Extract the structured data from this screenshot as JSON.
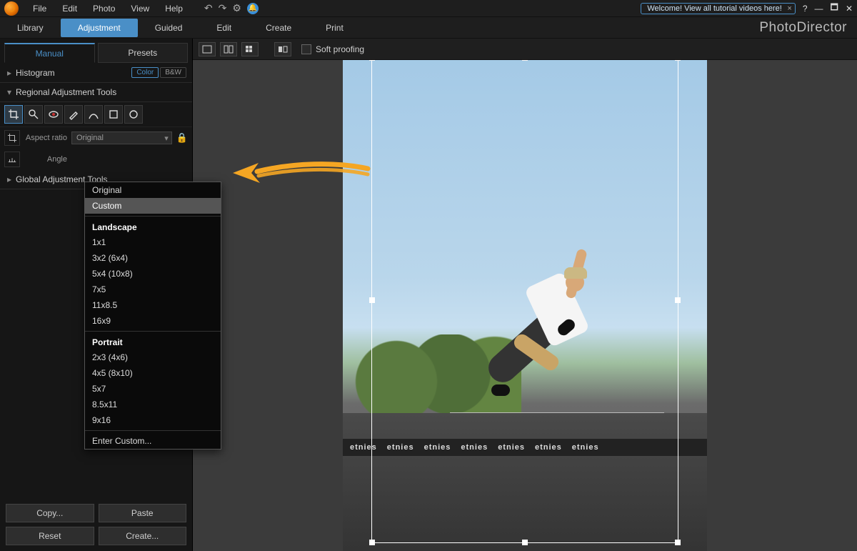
{
  "menubar": {
    "items": [
      "File",
      "Edit",
      "Photo",
      "View",
      "Help"
    ],
    "welcome": "Welcome! View all tutorial videos here!"
  },
  "modetabs": {
    "items": [
      "Library",
      "Adjustment",
      "Guided",
      "Edit",
      "Create",
      "Print"
    ],
    "active_index": 1,
    "appname": "PhotoDirector"
  },
  "subtabs": {
    "manual": "Manual",
    "presets": "Presets"
  },
  "sections": {
    "histogram": "Histogram",
    "regional": "Regional Adjustment Tools",
    "global": "Global Adjustment Tools",
    "color_pill": "Color",
    "bw_pill": "B&W"
  },
  "crop": {
    "aspect_label": "Aspect ratio",
    "aspect_value": "Original",
    "angle_label": "Angle"
  },
  "dropdown": {
    "top": [
      "Original",
      "Custom"
    ],
    "landscape_header": "Landscape",
    "landscape": [
      "1x1",
      "3x2 (6x4)",
      "5x4 (10x8)",
      "7x5",
      "11x8.5",
      "16x9"
    ],
    "portrait_header": "Portrait",
    "portrait": [
      "2x3 (4x6)",
      "4x5 (8x10)",
      "5x7",
      "8.5x11",
      "9x16"
    ],
    "enter_custom": "Enter Custom..."
  },
  "buttons": {
    "copy": "Copy...",
    "paste": "Paste",
    "reset": "Reset",
    "create": "Create..."
  },
  "canvas_toolbar": {
    "soft_proofing": "Soft proofing"
  },
  "banner_text": "etnies"
}
